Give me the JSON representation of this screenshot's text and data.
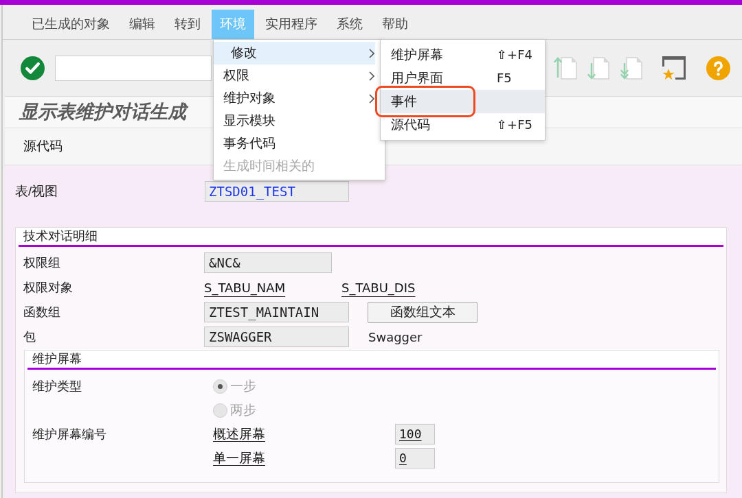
{
  "menubar": [
    {
      "label": "已生成的对象",
      "selected": false
    },
    {
      "label": "编辑",
      "selected": false
    },
    {
      "label": "转到",
      "selected": false
    },
    {
      "label": "环境",
      "selected": true
    },
    {
      "label": "实用程序",
      "selected": false
    },
    {
      "label": "系统",
      "selected": false
    },
    {
      "label": "帮助",
      "selected": false
    }
  ],
  "environment_menu": {
    "items": [
      {
        "label": "修改",
        "selected": true,
        "has_submenu": true,
        "disabled": false
      },
      {
        "label": "权限",
        "selected": false,
        "has_submenu": true,
        "disabled": false
      },
      {
        "label": "维护对象",
        "selected": false,
        "has_submenu": true,
        "disabled": false
      },
      {
        "label": "显示模块",
        "selected": false,
        "has_submenu": false,
        "disabled": false
      },
      {
        "label": "事务代码",
        "selected": false,
        "has_submenu": false,
        "disabled": false
      },
      {
        "label": "生成时间相关的",
        "selected": false,
        "has_submenu": false,
        "disabled": true
      }
    ]
  },
  "modify_submenu": {
    "items": [
      {
        "label": "维护屏幕",
        "shortcut": "⇧+F4",
        "selected": false,
        "annotated": false
      },
      {
        "label": "用户界面",
        "shortcut": "F5",
        "selected": false,
        "annotated": false
      },
      {
        "label": "事件",
        "selected": true,
        "annotated": true
      },
      {
        "label": "源代码",
        "shortcut": "⇧+F5",
        "selected": false,
        "annotated": false
      }
    ]
  },
  "title": "显示表维护对话生成",
  "app_toolbar": [
    {
      "label": "源代码"
    }
  ],
  "table_view": {
    "label": "表/视图",
    "value": "ZTSD01_TEST"
  },
  "technical_details": {
    "title": "技术对话明细",
    "rows": [
      {
        "kind": "field",
        "label": "权限组",
        "value": "&NC&"
      },
      {
        "kind": "links",
        "label": "权限对象",
        "links": [
          "S_TABU_NAM",
          "S_TABU_DIS"
        ]
      },
      {
        "kind": "field_button",
        "label": "函数组",
        "value": "ZTEST_MAINTAIN",
        "button": "函数组文本"
      },
      {
        "kind": "field_text",
        "label": "包",
        "value": "ZSWAGGER",
        "text": "Swagger"
      }
    ]
  },
  "maintenance_screens": {
    "title": "维护屏幕",
    "type_label": "维护类型",
    "options": [
      {
        "label": "一步",
        "selected": true,
        "disabled": true
      },
      {
        "label": "两步",
        "selected": false,
        "disabled": true
      }
    ],
    "numbers_label": "维护屏幕编号",
    "numbers": [
      {
        "label": "概述屏幕",
        "value": "100"
      },
      {
        "label": "单一屏幕",
        "value": "0"
      }
    ]
  }
}
